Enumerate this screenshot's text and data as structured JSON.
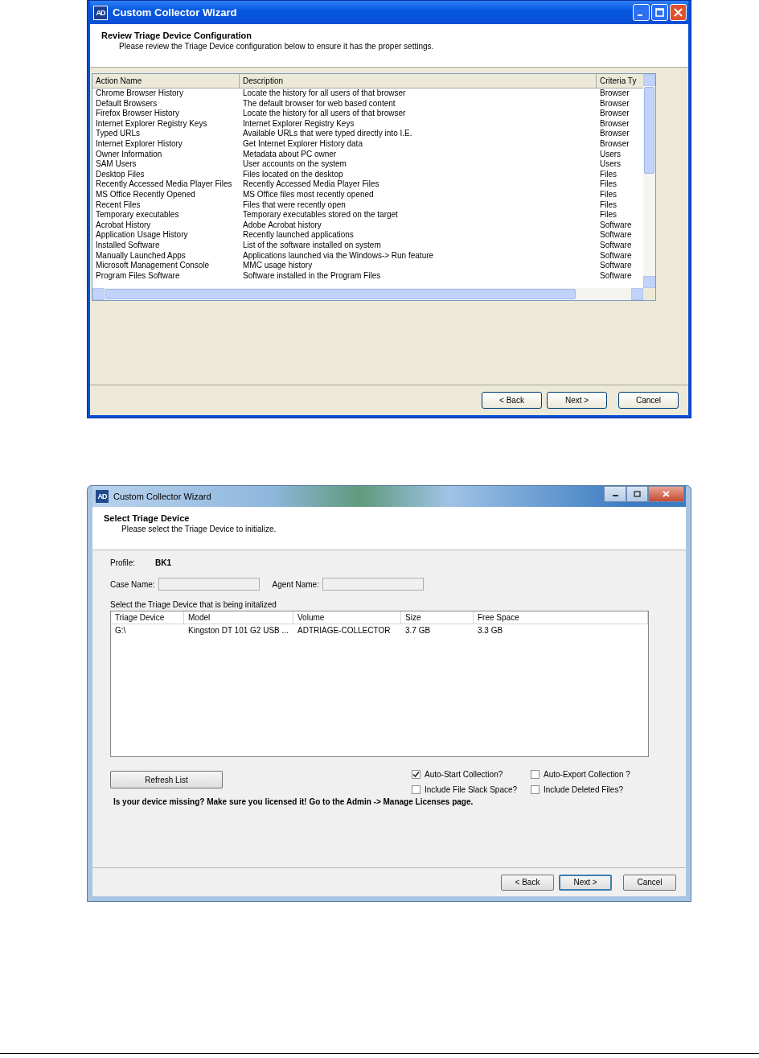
{
  "review_window": {
    "title": "Custom Collector Wizard",
    "logo": "AD",
    "heading": "Review Triage Device Configuration",
    "subheading": "Please review the Triage Device configuration below to ensure it has the proper settings.",
    "columns": [
      "Action Name",
      "Description",
      "Criteria Ty"
    ],
    "rows": [
      [
        "Chrome Browser History",
        "Locate the history for all users of that browser",
        "Browser"
      ],
      [
        "Default Browsers",
        "The default browser for web based content",
        "Browser"
      ],
      [
        "Firefox Browser History",
        "Locate the history for all users of that browser",
        "Browser"
      ],
      [
        "Internet Explorer Registry Keys",
        "Internet Explorer Registry Keys",
        "Browser"
      ],
      [
        "Typed URLs",
        "Available URLs that were typed directly into I.E.",
        "Browser"
      ],
      [
        "Internet Explorer History",
        "Get Internet Explorer History data",
        "Browser"
      ],
      [
        "Owner Information",
        "Metadata about PC owner",
        "Users"
      ],
      [
        "SAM Users",
        "User accounts on the system",
        "Users"
      ],
      [
        "Desktop Files",
        "Files located on the desktop",
        "Files"
      ],
      [
        "Recently Accessed Media Player Files",
        "Recently Accessed Media Player Files",
        "Files"
      ],
      [
        "MS Office Recently Opened",
        "MS Office files most recently opened",
        "Files"
      ],
      [
        "Recent Files",
        "Files that were recently open",
        "Files"
      ],
      [
        "Temporary executables",
        "Temporary executables stored on the target",
        "Files"
      ],
      [
        "Acrobat History",
        "Adobe Acrobat history",
        "Software"
      ],
      [
        "Application Usage History",
        "Recently launched applications",
        "Software"
      ],
      [
        "Installed Software",
        "List of the software installed on system",
        "Software"
      ],
      [
        "Manually Launched Apps",
        "Applications launched via the Windows-> Run feature",
        "Software"
      ],
      [
        "Microsoft Management Console",
        "MMC usage history",
        "Software"
      ],
      [
        "Program Files Software",
        "Software installed in the Program Files",
        "Software"
      ]
    ],
    "buttons": [
      "< Back",
      "Next >",
      "Cancel"
    ]
  },
  "select_window": {
    "title": "Custom Collector Wizard",
    "logo": "AD",
    "heading": "Select Triage Device",
    "subheading": "Please select the Triage Device to initialize.",
    "profile_label": "Profile:",
    "profile_value": "BK1",
    "fields": [
      {
        "label": "Case Name:"
      },
      {
        "label": "Agent Name:"
      }
    ],
    "list_label": "Select the Triage Device that is being initalized",
    "columns": [
      "Triage Device",
      "Model",
      "Volume",
      "Size",
      "Free Space"
    ],
    "rows": [
      [
        "G:\\",
        "Kingston DT 101 G2 USB ...",
        "ADTRIAGE-COLLECTOR",
        "3.7 GB",
        "3.3 GB"
      ]
    ],
    "refresh_button": "Refresh List",
    "options": [
      {
        "label": "Auto-Start Collection?",
        "checked": true
      },
      {
        "label": "Auto-Export Collection ?",
        "checked": false
      },
      {
        "label": "Include File Slack Space?",
        "checked": false
      },
      {
        "label": "Include Deleted Files?",
        "checked": false
      }
    ],
    "notice": "Is your device missing? Make sure you licensed it! Go to the Admin -> Manage Licenses page.",
    "buttons": [
      "< Back",
      "Next >",
      "Cancel"
    ]
  }
}
